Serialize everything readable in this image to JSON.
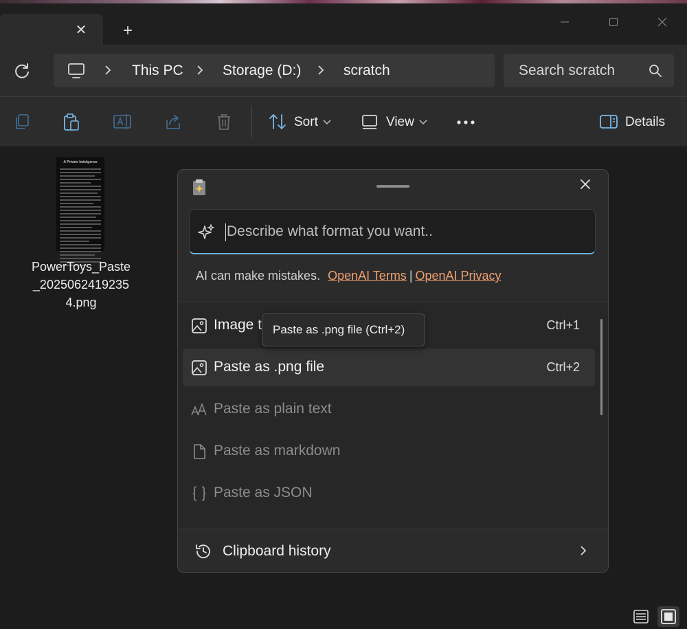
{
  "window": {
    "tab_close_glyph": "✕",
    "new_tab_glyph": "+"
  },
  "breadcrumb": [
    "This PC",
    "Storage (D:)",
    "scratch"
  ],
  "search": {
    "placeholder": "Search scratch"
  },
  "toolbar": {
    "sort_label": "Sort",
    "view_label": "View",
    "details_label": "Details"
  },
  "file": {
    "name": "PowerToys_Paste_20250624192354.png",
    "thumbnail_title": "A Private Indulgence"
  },
  "paste_panel": {
    "prompt_placeholder": "Describe what format you want..",
    "disclaimer": "AI can make mistakes.",
    "terms_link": "OpenAI Terms",
    "divider": "|",
    "privacy_link": "OpenAI Privacy",
    "items": [
      {
        "label": "Image to text",
        "shortcut": "Ctrl+1",
        "icon": "image-icon"
      },
      {
        "label": "Paste as .png file",
        "shortcut": "Ctrl+2",
        "icon": "image-icon"
      },
      {
        "label": "Paste as plain text",
        "shortcut": "",
        "icon": "font-size-icon"
      },
      {
        "label": "Paste as markdown",
        "shortcut": "",
        "icon": "document-icon"
      },
      {
        "label": "Paste as JSON",
        "shortcut": "",
        "icon": "braces-icon"
      }
    ],
    "tooltip": "Paste as .png file (Ctrl+2)",
    "footer_label": "Clipboard history"
  },
  "colors": {
    "accent": "#6cb4e4",
    "link": "#f0a070"
  }
}
